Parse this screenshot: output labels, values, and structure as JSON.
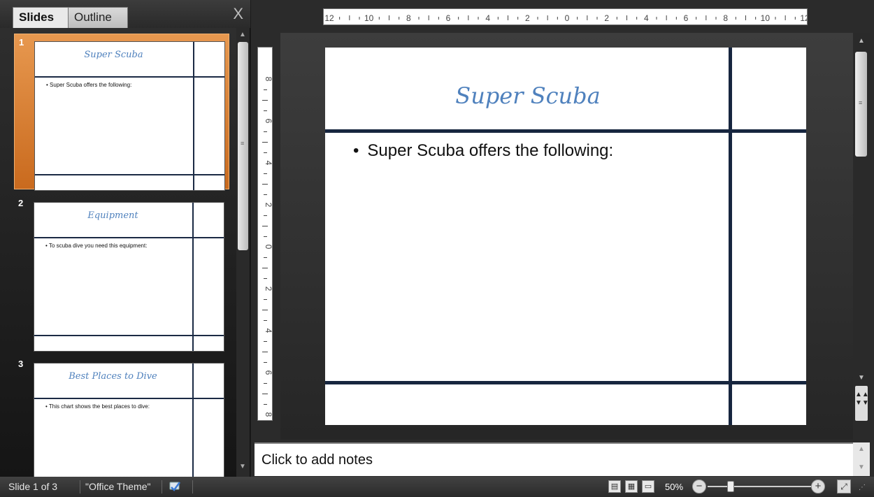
{
  "left_pane": {
    "tabs": [
      {
        "label": "Slides"
      },
      {
        "label": "Outline"
      }
    ],
    "close_glyph": "X",
    "slides": [
      {
        "number": "1",
        "title": "Super Scuba",
        "bullet": "Super Scuba offers the following:"
      },
      {
        "number": "2",
        "title": "Equipment",
        "bullet": "To scuba dive you need this equipment:"
      },
      {
        "number": "3",
        "title": "Best Places to Dive",
        "bullet": "This chart shows the best places to dive:"
      }
    ]
  },
  "rulers": {
    "top": "12 · · · 10 · · · 8 · · · 6 · · · 4 · · · 2 · · · 0 · · · 2 · · · 4 · · · 6 · · · 8 · · · 10 · · · 12",
    "left": "8 · · · 6 · · · 4 · · · 2 · · · 0 · · · 2 · · · 4 · · · 6 · · · 8"
  },
  "main_slide": {
    "title": "Super Scuba",
    "bullet": "Super Scuba offers the following:",
    "bullet_dot": "•"
  },
  "notes": {
    "placeholder": "Click to add notes"
  },
  "status_bar": {
    "slide_info": "Slide 1 of 3",
    "theme": "\"Office Theme\"",
    "zoom": "50%",
    "zoom_level_percent": 50
  },
  "colors": {
    "title_accent": "#4f81bd",
    "line_navy": "#17263f",
    "selected_orange": "#e7984f"
  },
  "icons": [
    "close-icon",
    "spell-check-icon",
    "normal-view-icon",
    "slide-sorter-icon",
    "slideshow-icon",
    "zoom-out-icon",
    "zoom-in-icon",
    "fit-window-icon"
  ]
}
